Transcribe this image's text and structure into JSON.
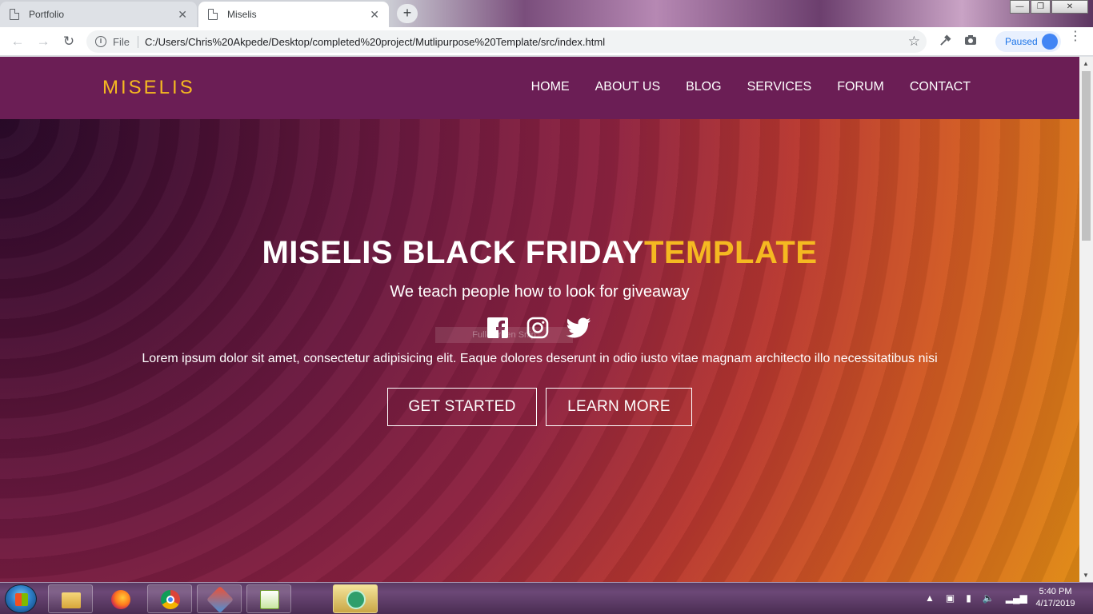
{
  "browser": {
    "tabs": [
      {
        "title": "Portfolio",
        "close": "✕"
      },
      {
        "title": "Miselis",
        "close": "✕"
      }
    ],
    "new_tab": "+",
    "nav": {
      "back": "←",
      "forward": "→",
      "reload": "↻"
    },
    "address": {
      "scheme": "File",
      "url": "C:/Users/Chris%20Akpede/Desktop/completed%20project/Mutlipurpose%20Template/src/index.html"
    },
    "bookmark_star": "☆",
    "profile_status": "Paused",
    "window_controls": {
      "minimize": "—",
      "maximize": "❐",
      "close": "✕"
    }
  },
  "site": {
    "logo": "MISELIS",
    "nav": [
      "HOME",
      "ABOUT US",
      "BLOG",
      "SERVICES",
      "FORUM",
      "CONTACT"
    ],
    "hero": {
      "title_main": "MISELIS BLACK FRIDAY",
      "title_accent": "TEMPLATE",
      "overlay_label": "Full-screen Snip",
      "tagline": "We teach people how to look for giveaway",
      "body": "Lorem ipsum dolor sit amet, consectetur adipisicing elit. Eaque dolores deserunt in odio iusto vitae magnam architecto illo necessitatibus nisi",
      "buttons": {
        "primary": "GET STARTED",
        "secondary": "LEARN MORE"
      },
      "socials": [
        "facebook-icon",
        "instagram-icon",
        "twitter-icon"
      ]
    }
  },
  "taskbar": {
    "apps": [
      "file-explorer",
      "firefox",
      "chrome",
      "git-client",
      "notepad-plus-plus",
      "atom"
    ],
    "clock": {
      "time": "5:40 PM",
      "date": "4/17/2019"
    }
  },
  "colors": {
    "brand_header": "#6b1e55",
    "accent": "#f5b921"
  }
}
